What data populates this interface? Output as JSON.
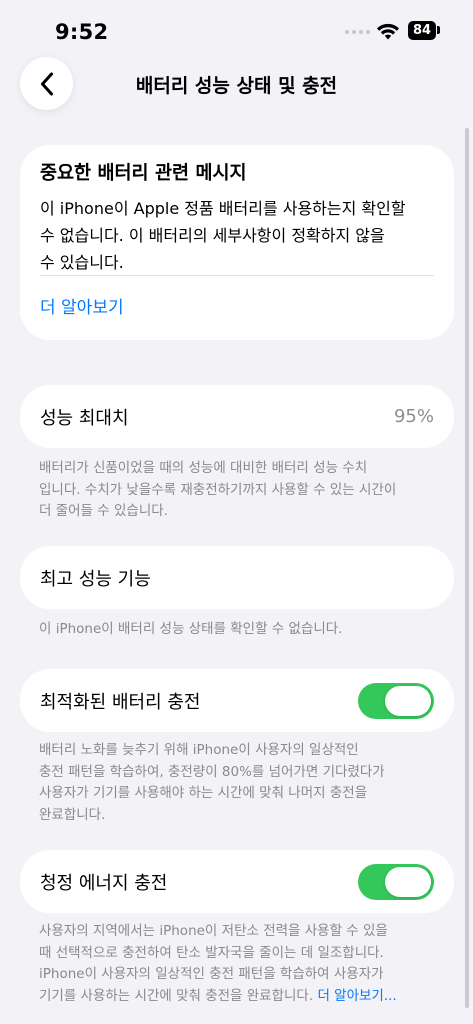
{
  "status_bar": {
    "time": "9:52",
    "battery": "84"
  },
  "header": {
    "title": "배터리 성능 상태 및 충전"
  },
  "message_card": {
    "title": "중요한 배터리 관련 메시지",
    "body_line1": "이 iPhone이 Apple 정품 배터리를 사용하는지 확인할",
    "body_line2": "수 없습니다. 이 배터리의 세부사항이 정확하지 않을",
    "body_line3": "수 있습니다.",
    "learn_more": "더 알아보기"
  },
  "max_capacity": {
    "label": "성능 최대치",
    "value": "95%",
    "note_line1": "배터리가 신품이었을 때의 성능에 대비한 배터리 성능 수치",
    "note_line2": "입니다. 수치가 낮을수록 재충전하기까지 사용할 수 있는 시간이",
    "note_line3": "더 줄어들 수 있습니다."
  },
  "peak_performance": {
    "label": "최고 성능 기능",
    "note": "이 iPhone이 배터리 성능 상태를 확인할 수 없습니다."
  },
  "optimized_charging": {
    "label": "최적화된 배터리 충전",
    "enabled": true,
    "note_line1": "배터리 노화를 늦추기 위해 iPhone이 사용자의 일상적인",
    "note_line2": "충전 패턴을 학습하여, 충전량이 80%를 넘어가면 기다렸다가",
    "note_line3": "사용자가 기기를 사용해야 하는 시간에 맞춰 나머지 충전을",
    "note_line4": "완료합니다."
  },
  "clean_energy": {
    "label": "청정 에너지 충전",
    "enabled": true,
    "note_line1": "사용자의 지역에서는 iPhone이 저탄소 전력을 사용할 수 있을",
    "note_line2": "때 선택적으로 충전하여 탄소 발자국을 줄이는 데 일조합니다.",
    "note_line3": "iPhone이 사용자의 일상적인 충전 패턴을 학습하여 사용자가",
    "note_line4": "기기를 사용하는 시간에 맞춰 충전을 완료합니다.",
    "learn_more": "더 알아보기..."
  },
  "colors": {
    "accent": "#007aff",
    "toggle_on": "#34c759",
    "background": "#f2f2f7"
  }
}
